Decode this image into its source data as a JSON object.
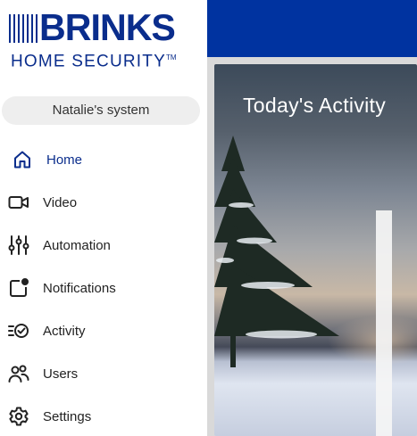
{
  "brand": {
    "name": "BRINKS",
    "tagline": "HOME SECURITY",
    "trademark": "TM",
    "color": "#0a2d8c",
    "topbar_color": "#0033a0"
  },
  "system": {
    "name": "Natalie's system"
  },
  "nav": {
    "items": [
      {
        "label": "Home",
        "icon": "home-icon",
        "active": true
      },
      {
        "label": "Video",
        "icon": "video-camera-icon",
        "active": false
      },
      {
        "label": "Automation",
        "icon": "sliders-icon",
        "active": false
      },
      {
        "label": "Notifications",
        "icon": "notification-icon",
        "active": false
      },
      {
        "label": "Activity",
        "icon": "activity-list-icon",
        "active": false
      },
      {
        "label": "Users",
        "icon": "users-icon",
        "active": false
      },
      {
        "label": "Settings",
        "icon": "gear-icon",
        "active": false
      }
    ]
  },
  "main": {
    "card_title": "Today's Activity"
  }
}
